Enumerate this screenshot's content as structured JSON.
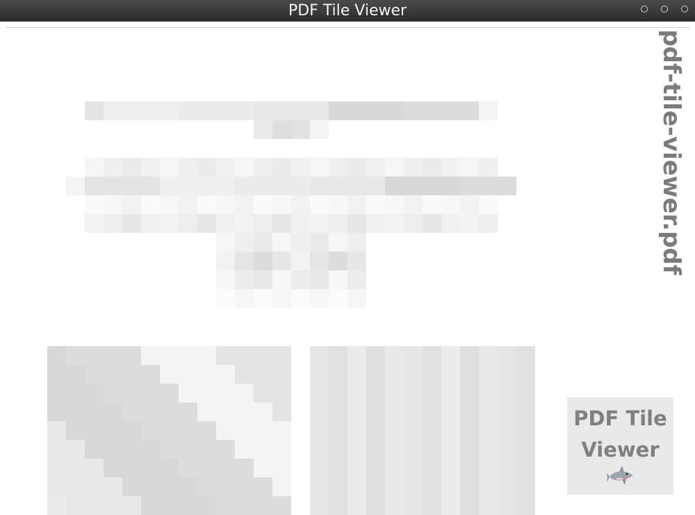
{
  "window": {
    "title": "PDF Tile Viewer",
    "controls": [
      {
        "name": "minimize"
      },
      {
        "name": "maximize"
      },
      {
        "name": "close"
      }
    ]
  },
  "document": {
    "filename": "pdf-tile-viewer.pdf",
    "content_state": "pixelated"
  },
  "logo": {
    "text": "PDF Tile Viewer",
    "icon": "shark-icon"
  },
  "colors": {
    "titlebar": "#333333",
    "title_text": "#f2f2f2",
    "filename_text": "#7b7b7b",
    "logo_bg": "#e9e9e9",
    "logo_text": "#808080"
  }
}
